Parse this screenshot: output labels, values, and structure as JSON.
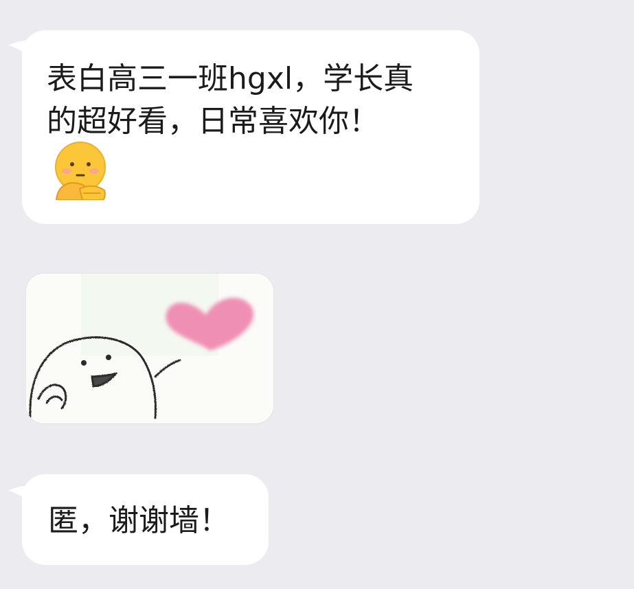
{
  "messages": [
    {
      "type": "text",
      "text": "表白高三一班hgxl，学长真\n的超好看，日常喜欢你！",
      "emoji": "shy-blush-emoji"
    },
    {
      "type": "sticker",
      "sticker": "doodle-character-with-pink-heart"
    },
    {
      "type": "text",
      "text": "匿，谢谢墙！"
    }
  ],
  "colors": {
    "background": "#ebebf0",
    "bubble": "#ffffff",
    "text": "#1b1b1b",
    "heart": "#ef8fb3",
    "emoji": "#fbc638"
  }
}
